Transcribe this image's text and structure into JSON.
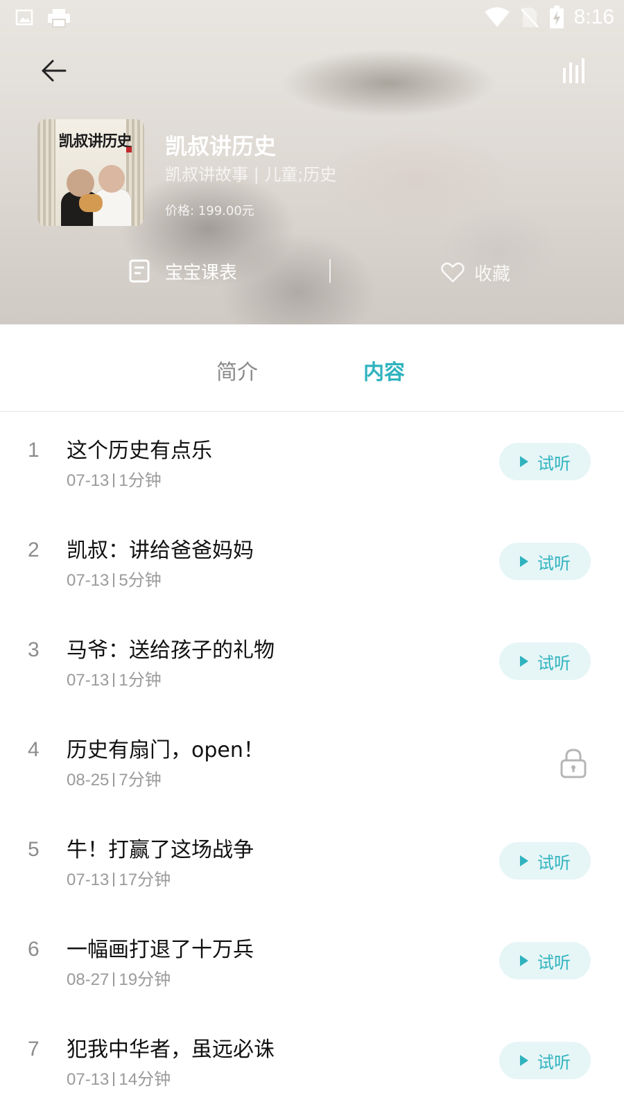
{
  "status_bar": {
    "time": "8:16",
    "left_icons": [
      "image-icon",
      "printer-icon"
    ],
    "right_icons": [
      "wifi-icon",
      "no-sim-icon",
      "battery-charging-icon"
    ]
  },
  "album": {
    "cover_text": "凯叔讲历史",
    "title": "凯叔讲历史",
    "subtitle": "凯叔讲故事 | 儿童;历史",
    "price": "价格: 199.00元"
  },
  "actions": {
    "schedule_label": "宝宝课表",
    "favorite_label": "收藏"
  },
  "tabs": [
    {
      "label": "简介",
      "active": false
    },
    {
      "label": "内容",
      "active": true
    }
  ],
  "colors": {
    "accent": "#2fb3be",
    "trial_bg": "#e6f5f6"
  },
  "episodes": [
    {
      "num": "1",
      "title": "这个历史有点乐",
      "date": "07-13",
      "duration": "1分钟",
      "trial_label": "试听",
      "locked": false
    },
    {
      "num": "2",
      "title": "凯叔：讲给爸爸妈妈",
      "date": "07-13",
      "duration": "5分钟",
      "trial_label": "试听",
      "locked": false
    },
    {
      "num": "3",
      "title": "马爷：送给孩子的礼物",
      "date": "07-13",
      "duration": "1分钟",
      "trial_label": "试听",
      "locked": false
    },
    {
      "num": "4",
      "title": "历史有扇门，open！",
      "date": "08-25",
      "duration": "7分钟",
      "trial_label": "",
      "locked": true
    },
    {
      "num": "5",
      "title": "牛！打赢了这场战争",
      "date": "07-13",
      "duration": "17分钟",
      "trial_label": "试听",
      "locked": false
    },
    {
      "num": "6",
      "title": "一幅画打退了十万兵",
      "date": "08-27",
      "duration": "19分钟",
      "trial_label": "试听",
      "locked": false
    },
    {
      "num": "7",
      "title": "犯我中华者，虽远必诛",
      "date": "07-13",
      "duration": "14分钟",
      "trial_label": "试听",
      "locked": false
    }
  ]
}
